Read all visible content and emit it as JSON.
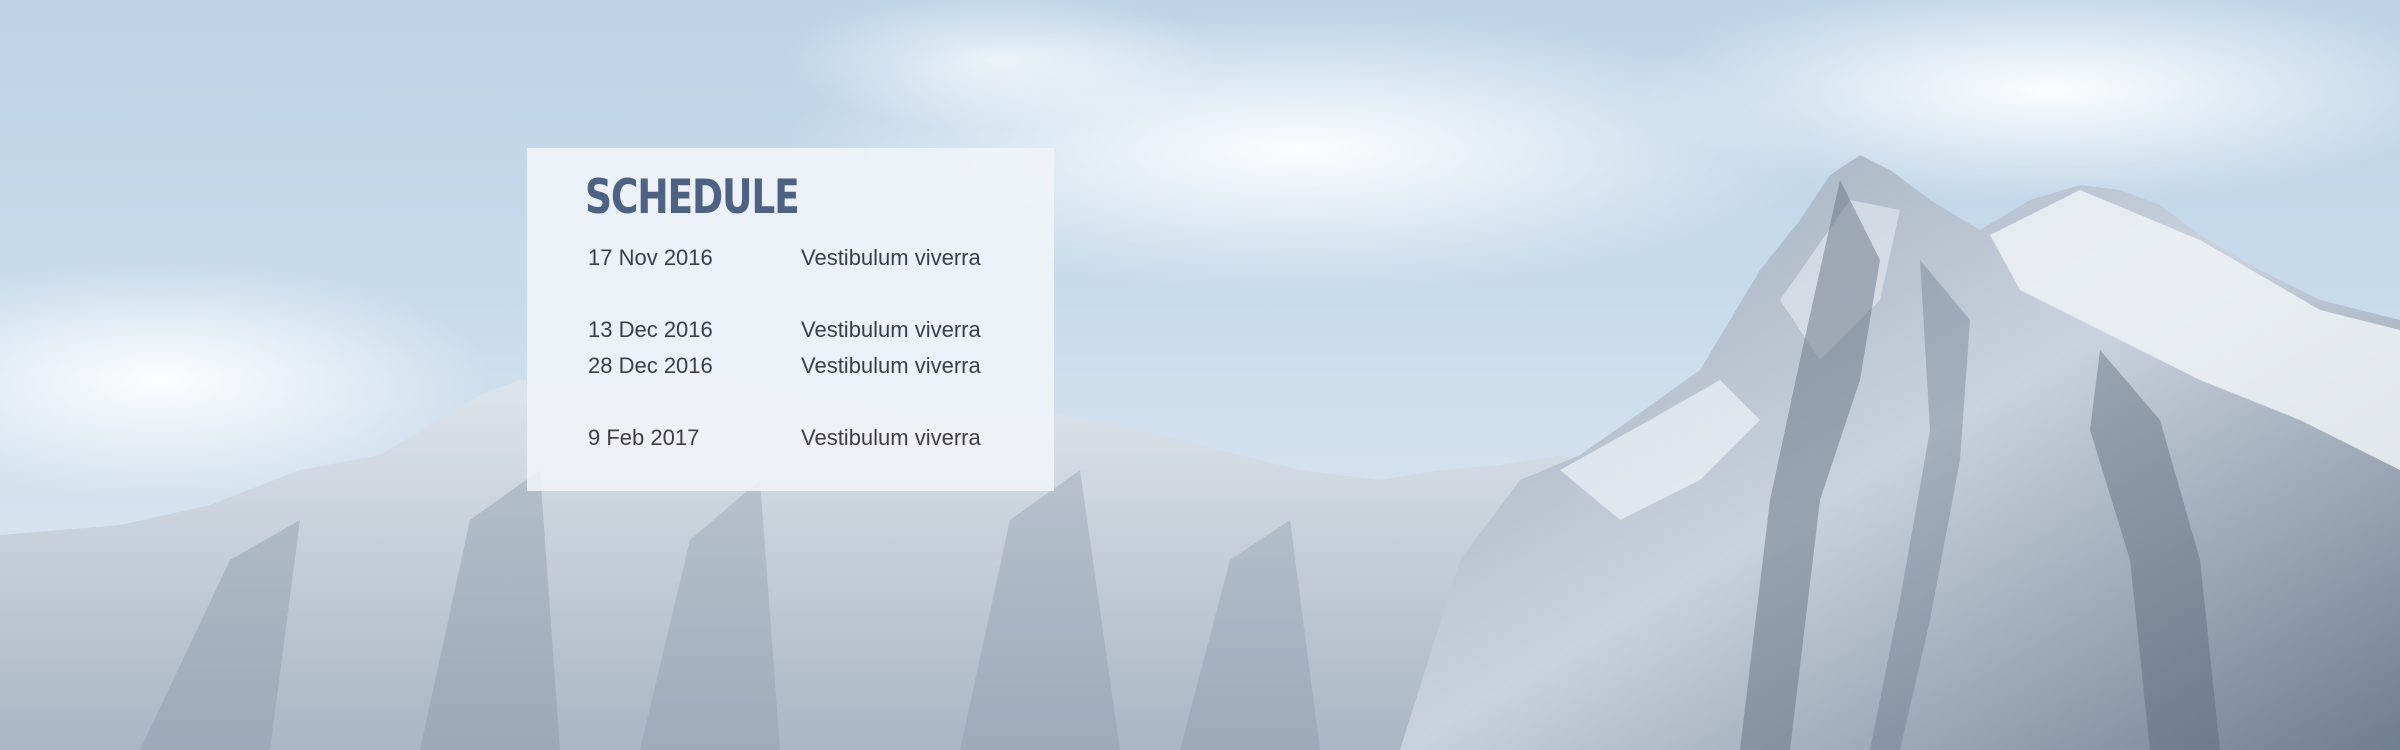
{
  "schedule": {
    "title": "SCHEDULE",
    "rows": [
      {
        "date": "17 Nov 2016",
        "event": "Vestibulum viverra"
      },
      {
        "date": "13 Dec 2016",
        "event": "Vestibulum viverra"
      },
      {
        "date": "28 Dec 2016",
        "event": "Vestibulum viverra"
      },
      {
        "date": "9 Feb 2017",
        "event": "Vestibulum viverra"
      }
    ]
  },
  "colors": {
    "title": "#4d6282",
    "text": "#3a3f48",
    "card": "#f1f4f8"
  }
}
